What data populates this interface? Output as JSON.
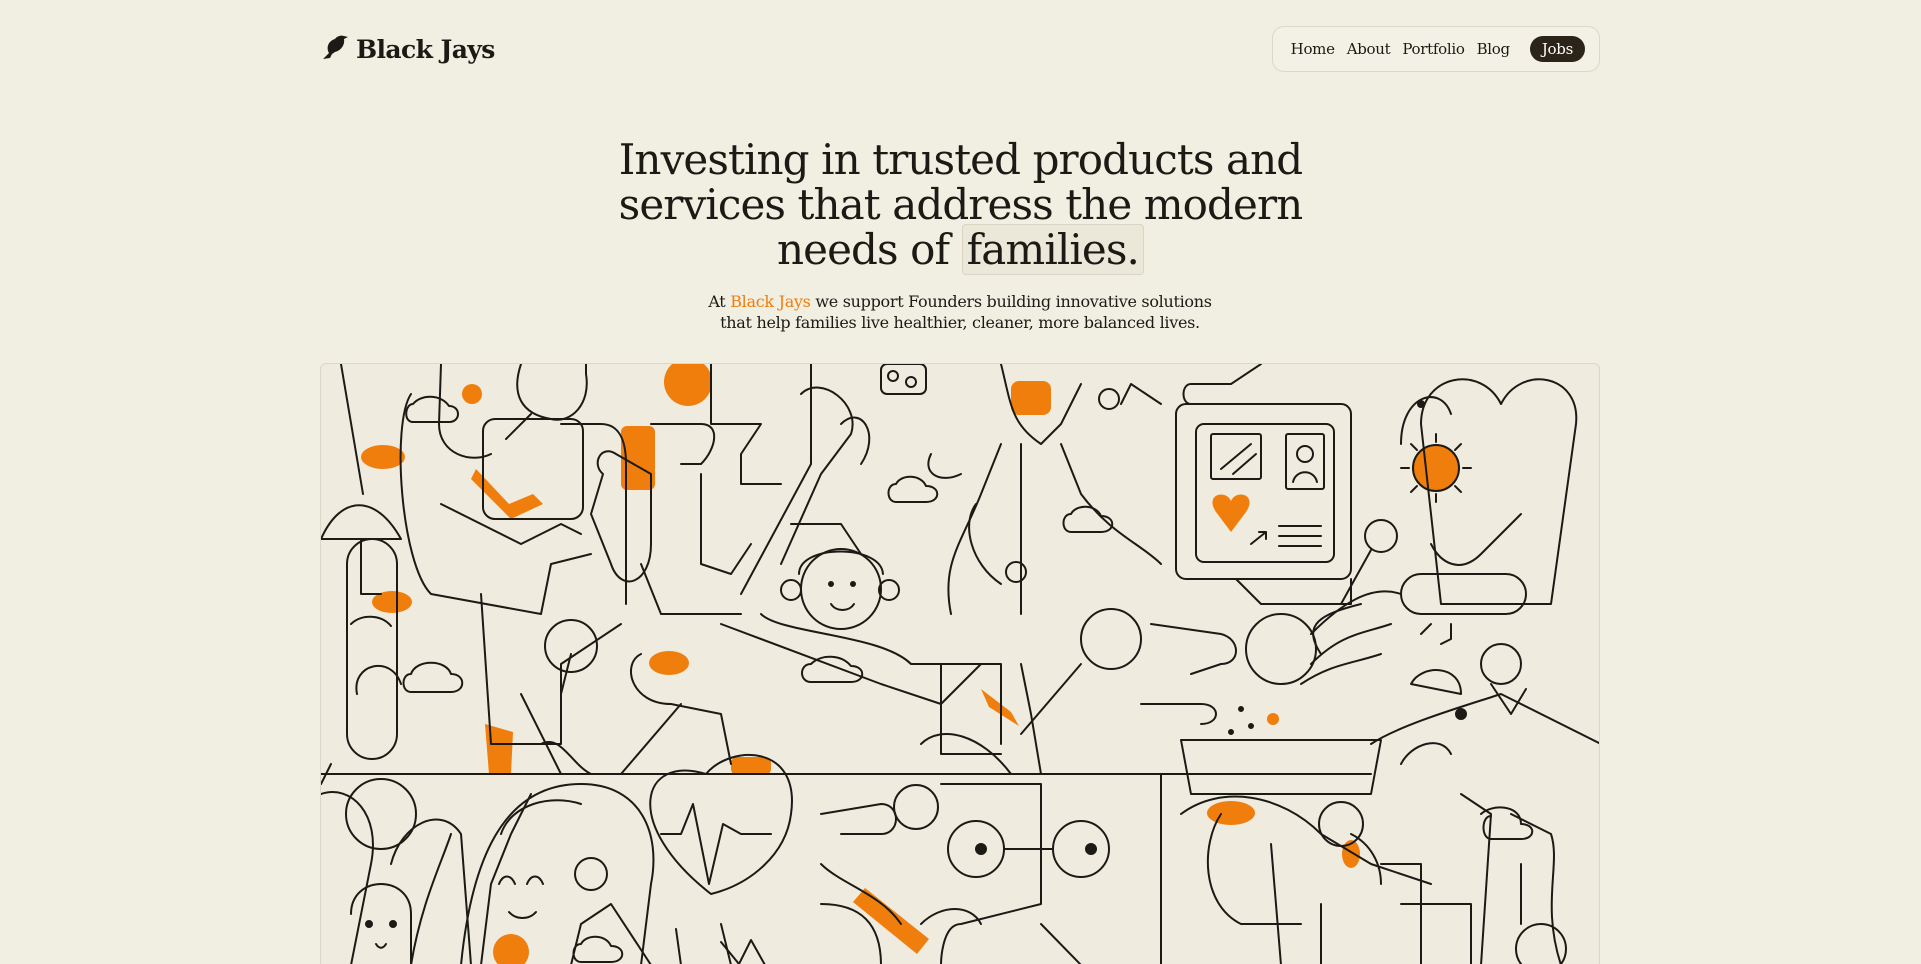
{
  "brand": {
    "name": "Black Jays",
    "logo_icon": "bird-icon"
  },
  "nav": {
    "items": [
      {
        "label": "Home"
      },
      {
        "label": "About"
      },
      {
        "label": "Portfolio"
      },
      {
        "label": "Blog"
      }
    ],
    "jobs_label": "Jobs"
  },
  "hero": {
    "title_line1": "Investing in trusted products and",
    "title_line2": "services that address the modern",
    "title_line3_prefix": "needs of ",
    "title_highlight": "families.",
    "sub_prefix": "At ",
    "sub_brand": "Black Jays",
    "sub_rest_line1": " we support Founders building innovative solutions",
    "sub_line2": "that help families live healthier, cleaner, more balanced lives."
  },
  "colors": {
    "background": "#f1eee2",
    "accent": "#f07e0c",
    "ink": "#1c1a15",
    "button_dark": "#2b2418"
  }
}
